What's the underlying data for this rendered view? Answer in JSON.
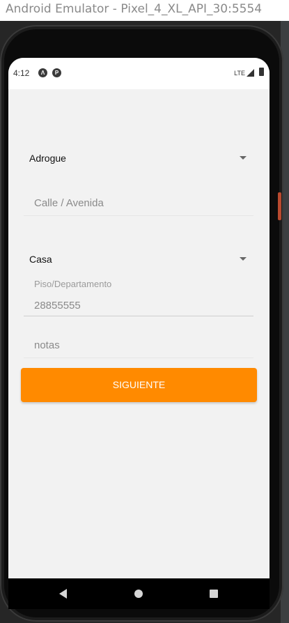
{
  "window": {
    "title": "Android Emulator - Pixel_4_XL_API_30:5554"
  },
  "status_bar": {
    "time": "4:12",
    "icons": [
      "app-notification-icon-a",
      "app-notification-icon-p"
    ],
    "network": "LTE",
    "signal_icon": "cell-signal-icon",
    "battery_icon": "battery-icon"
  },
  "form": {
    "locality_select": {
      "value": "Adrogue"
    },
    "street_field": {
      "placeholder": "Calle / Avenida",
      "value": ""
    },
    "type_select": {
      "value": "Casa"
    },
    "floor_field": {
      "label": "Piso/Departamento",
      "value": "28855555"
    },
    "notes_field": {
      "placeholder": "notas",
      "value": ""
    },
    "next_button": {
      "label": "SIGUIENTE"
    }
  },
  "nav_bar": {
    "buttons": [
      "back-icon",
      "home-icon",
      "recents-icon"
    ]
  },
  "colors": {
    "accent": "#ff8a00",
    "screen_bg": "#f2f2f2"
  }
}
